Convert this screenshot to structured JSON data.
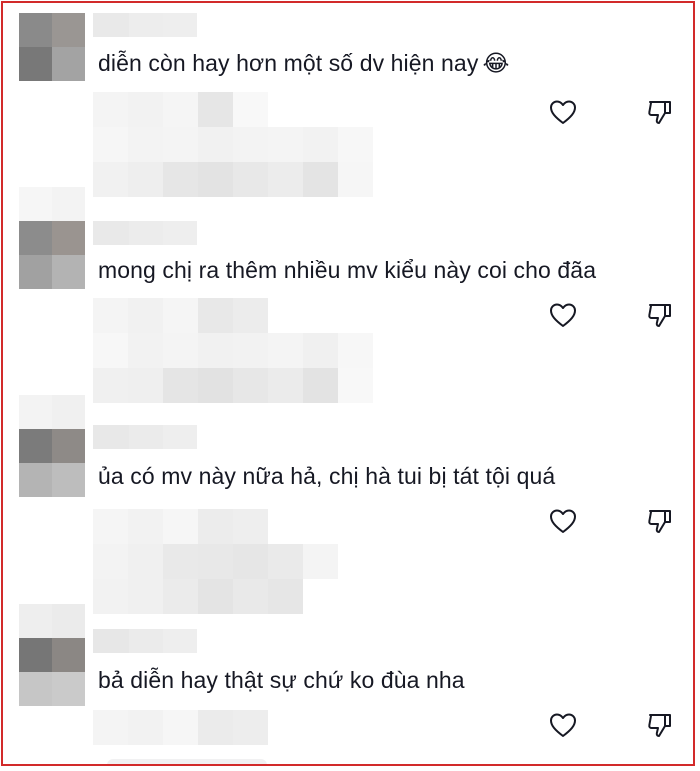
{
  "comments": [
    {
      "text": "diễn còn hay hơn một số dv hiện nay",
      "emoji": "😂"
    },
    {
      "text": "mong chị ra thêm nhiều mv kiểu này coi cho đãa"
    },
    {
      "text": "ủa có mv này nữa hả, chị hà tui bị tát tội quá"
    },
    {
      "text": "bả diễn hay thật sự chứ ko đùa nha"
    }
  ],
  "colors": {
    "text": "#161823",
    "icon": "#161823",
    "frame_border": "#d22a2a"
  },
  "icons": {
    "like": "heart-outline-icon",
    "dislike": "thumbs-down-outline-icon"
  }
}
